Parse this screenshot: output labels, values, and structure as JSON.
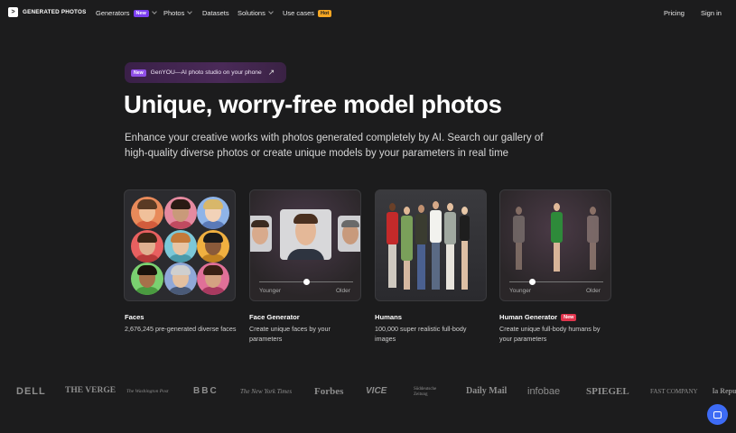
{
  "brand": {
    "name": "GENERATED PHOTOS",
    "logo_glyph": ">"
  },
  "nav": {
    "items": [
      {
        "label": "Generators",
        "badge": "New"
      },
      {
        "label": "Photos"
      },
      {
        "label": "Datasets"
      },
      {
        "label": "Solutions"
      },
      {
        "label": "Use cases",
        "badge": "Hot"
      }
    ],
    "pricing": "Pricing",
    "signin": "Sign in"
  },
  "promo": {
    "tag": "New",
    "text": "GenYOU—AI photo studio on your phone",
    "icon": "arrow-up-right-icon"
  },
  "hero": {
    "title": "Unique, worry-free model photos",
    "subtitle": "Enhance your creative works with photos generated completely by AI. Search our gallery of high-quality diverse photos or create unique models by your parameters in real time"
  },
  "cards": [
    {
      "title": "Faces",
      "desc": "2,676,245 pre-generated diverse faces"
    },
    {
      "title": "Face Generator",
      "desc": "Create unique faces by your parameters",
      "slider": {
        "left": "Younger",
        "right": "Older"
      }
    },
    {
      "title": "Humans",
      "desc": "100,000 super realistic full-body images"
    },
    {
      "title": "Human Generator",
      "badge": "New",
      "desc": "Create unique full-body humans by your parameters",
      "slider": {
        "left": "Younger",
        "right": "Older"
      }
    }
  ],
  "press_logos": [
    "DELL",
    "THE VERGE",
    "The Washington Post",
    "BBC",
    "The New York Times",
    "Forbes",
    "VICE",
    "Süddeutsche Zeitung",
    "Daily Mail",
    "infobae",
    "SPIEGEL",
    "FAST COMPANY",
    "la Repubblica"
  ],
  "colors": {
    "background": "#1c1c1d",
    "new_badge": "#7b3ff2",
    "hot_badge": "#f5a623",
    "chat_button": "#3d6bf5"
  }
}
